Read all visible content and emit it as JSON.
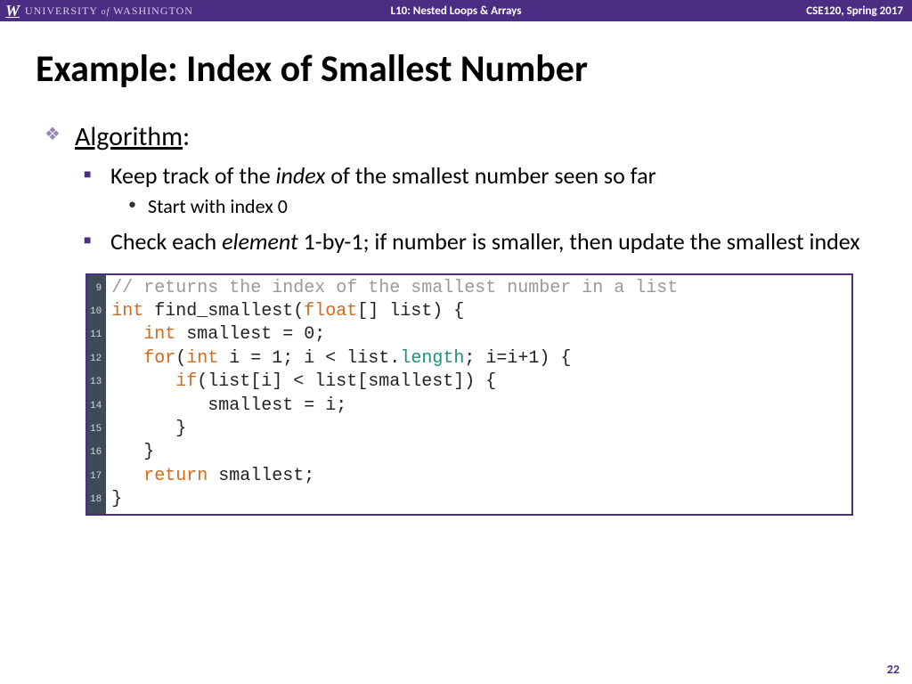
{
  "header": {
    "university_prefix": "UNIVERSITY",
    "university_of": "of",
    "university_name": "WASHINGTON",
    "lecture": "L10:  Nested Loops & Arrays",
    "course": "CSE120, Spring 2017"
  },
  "title": "Example:  Index of Smallest Number",
  "bullets": {
    "algorithm_label": "Algorithm",
    "colon": ":",
    "b1_pre": "Keep track of the ",
    "b1_em": "index",
    "b1_post": " of the smallest number seen so far",
    "b1_sub": "Start with index 0",
    "b2_pre": "Check each ",
    "b2_em": "element",
    "b2_post": " 1-by-1; if number is smaller, then update the smallest index"
  },
  "code": {
    "line_numbers": [
      "9",
      "10",
      "11",
      "12",
      "13",
      "14",
      "15",
      "16",
      "17",
      "18"
    ],
    "l9_comment": "// returns the index of the smallest number in a list",
    "l10_kw1": "int",
    "l10_mid": " find_smallest(",
    "l10_kw2": "float",
    "l10_tail": "[] list) {",
    "l11_indent": "   ",
    "l11_kw": "int",
    "l11_tail": " smallest = 0;",
    "l12_indent": "   ",
    "l12_kw1": "for",
    "l12_p1": "(",
    "l12_kw2": "int",
    "l12_mid": " i = 1; i < list.",
    "l12_attr": "length",
    "l12_tail": "; i=i+1) {",
    "l13_indent": "      ",
    "l13_kw": "if",
    "l13_tail": "(list[i] < list[smallest]) {",
    "l14": "         smallest = i;",
    "l15": "      }",
    "l16": "   }",
    "l17_indent": "   ",
    "l17_kw": "return",
    "l17_tail": " smallest;",
    "l18": "}"
  },
  "page_number": "22"
}
